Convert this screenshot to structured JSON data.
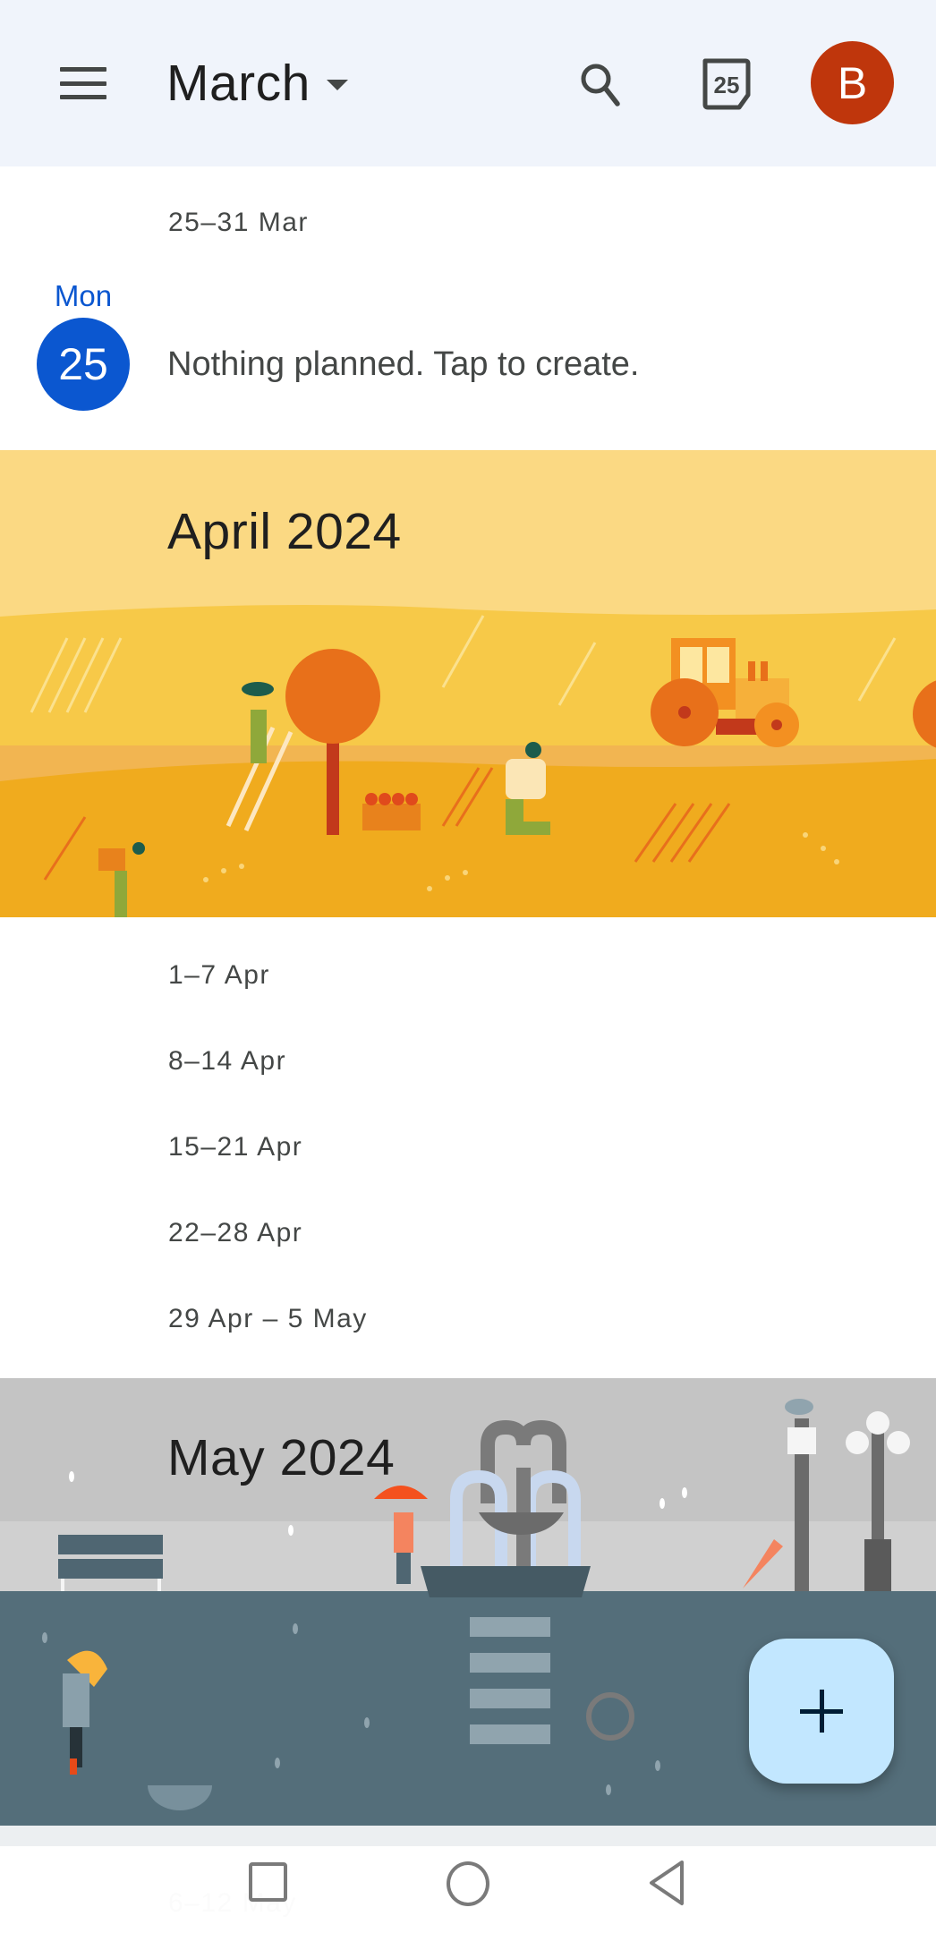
{
  "header": {
    "menu_icon": "hamburger-menu-icon",
    "title": "March",
    "title_dropdown_icon": "caret-down-icon",
    "search_icon": "search-icon",
    "today_icon": "calendar-today-icon",
    "today_day": "25",
    "avatar_initial": "B",
    "avatar_color": "#bf360c",
    "background": "#f0f4fb"
  },
  "march": {
    "week_label": "25–31 Mar",
    "day": {
      "weekday": "Mon",
      "date": "25",
      "accent": "#0b57d0",
      "empty_message": "Nothing planned. Tap to create."
    }
  },
  "april": {
    "banner_title": "April 2024",
    "banner_theme": "harvest-illustration",
    "weeks": [
      {
        "label": "1–7 Apr"
      },
      {
        "label": "8–14 Apr"
      },
      {
        "label": "15–21 Apr"
      },
      {
        "label": "22–28 Apr"
      },
      {
        "label": "29 Apr – 5 May"
      }
    ]
  },
  "may": {
    "banner_title": "May 2024",
    "banner_theme": "rainy-park-illustration",
    "weeks": [
      {
        "label": "6–12 May"
      }
    ]
  },
  "fab": {
    "icon": "plus-icon",
    "color": "#c2e7ff"
  },
  "system_nav": {
    "recents_icon": "recents-square-icon",
    "home_icon": "home-circle-icon",
    "back_icon": "back-triangle-icon"
  }
}
